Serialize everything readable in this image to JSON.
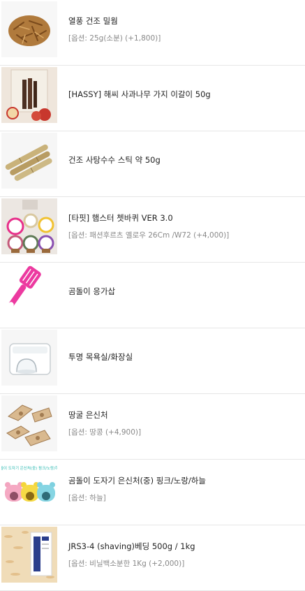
{
  "items": [
    {
      "name": "열풍 건조 밀웜",
      "option": "[옵션: 25g(소분) (+1,800)]",
      "image": "mealworm-photo"
    },
    {
      "name": "[HASSY] 해씨 사과나무 가지 이갈이 50g",
      "option": "",
      "image": "apple-branch-photo"
    },
    {
      "name": "건조 사탕수수 스틱 약 50g",
      "option": "",
      "image": "sugarcane-photo"
    },
    {
      "name": "[타핏] 햄스터 쳇바퀴 VER 3.0",
      "option": "[옵션: 패션후르츠 옐로우 26Cm /W72 (+4,000)]",
      "image": "wheel-photo"
    },
    {
      "name": "곰돌이 응가삽",
      "option": "",
      "image": "scoop-photo"
    },
    {
      "name": "투명 목욕실/화장실",
      "option": "",
      "image": "bathhouse-photo"
    },
    {
      "name": "땅굴 은신처",
      "option": "[옵션: 땅콩 (+4,900)]",
      "image": "tunnel-photo"
    },
    {
      "name": "곰돌이 도자기 은신처(중) 핑크/노랑/하늘",
      "option": "[옵션: 하늘]",
      "image": "ceramic-hideout-photo",
      "image_caption": "곰돌이 도자기 은신처(중) 핑크/노랑/하늘"
    },
    {
      "name": "JRS3-4 (shaving)베딩 500g / 1kg",
      "option": "[옵션: 비닐백소분한 1Kg (+2,000)]",
      "image": "bedding-photo"
    }
  ]
}
